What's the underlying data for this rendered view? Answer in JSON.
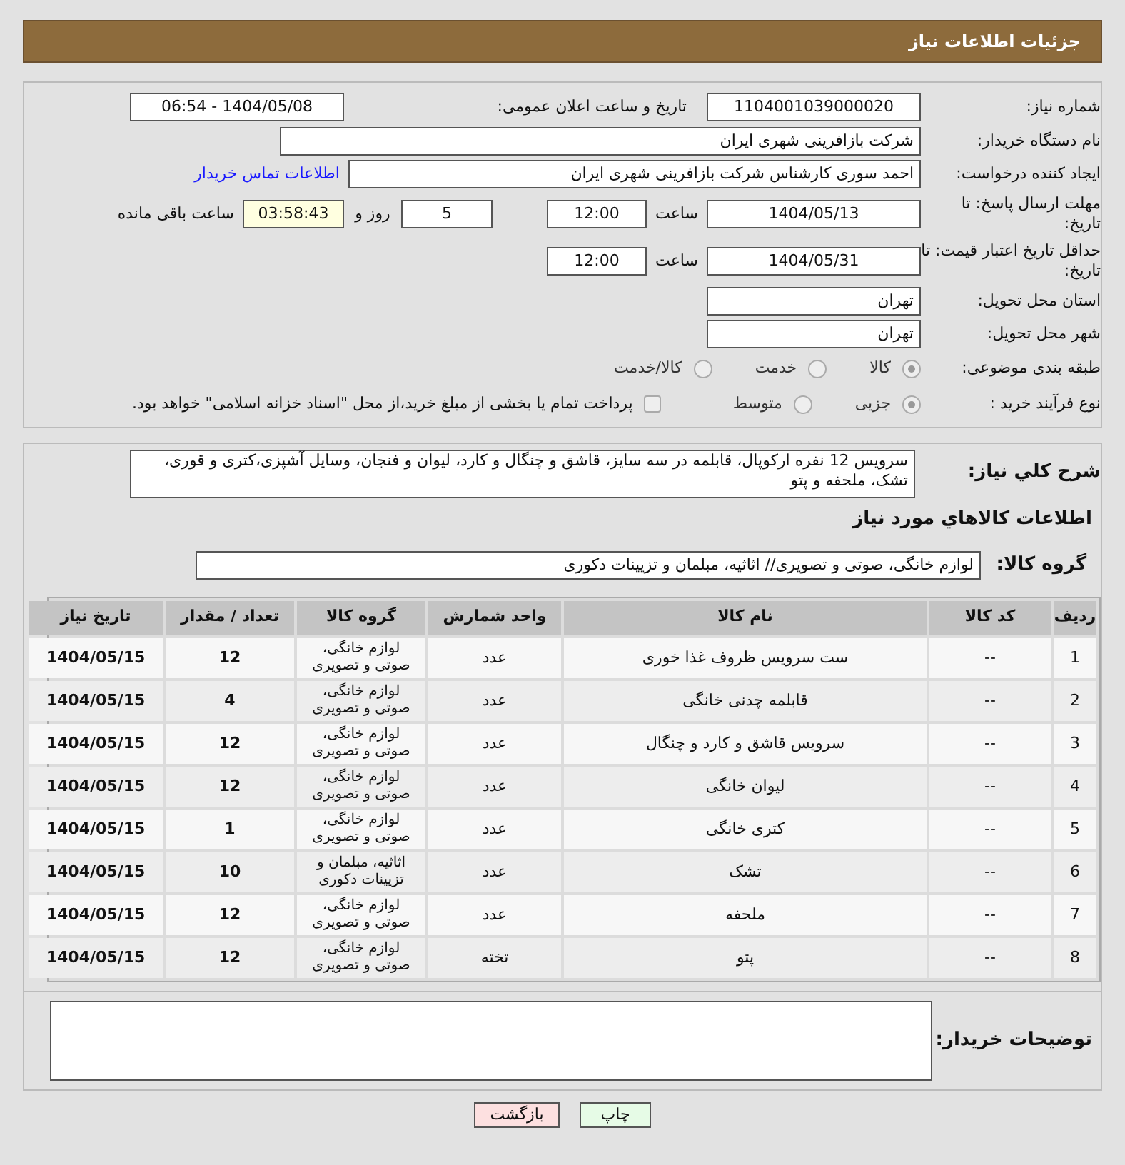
{
  "header": {
    "title": "جزئیات اطلاعات نیاز"
  },
  "need_number": {
    "label": "شماره نیاز:",
    "value": "1104001039000020"
  },
  "announce": {
    "label": "تاریخ و ساعت اعلان عمومی:",
    "value": "1404/05/08 - 06:54"
  },
  "buyer_org": {
    "label": "نام دستگاه خریدار:",
    "value": "شرکت بازافرینی شهری ایران"
  },
  "requester": {
    "label": "ایجاد کننده درخواست:",
    "value": "احمد سوری کارشناس شرکت بازافرینی شهری ایران",
    "link": "اطلاعات تماس خریدار"
  },
  "reply_deadline": {
    "label": "مهلت ارسال پاسخ: تا تاریخ:",
    "date": "1404/05/13",
    "time_label": "ساعت",
    "time": "12:00",
    "days": "5",
    "days_label": "روز و",
    "remaining": "03:58:43",
    "remaining_label": "ساعت باقی مانده"
  },
  "price_validity": {
    "label": "حداقل تاریخ اعتبار قیمت: تا تاریخ:",
    "date": "1404/05/31",
    "time_label": "ساعت",
    "time": "12:00"
  },
  "province": {
    "label": "استان محل تحویل:",
    "value": "تهران"
  },
  "city": {
    "label": "شهر محل تحویل:",
    "value": "تهران"
  },
  "classification": {
    "label": "طبقه بندی موضوعی:",
    "options": [
      {
        "label": "کالا",
        "selected": true
      },
      {
        "label": "خدمت",
        "selected": false
      },
      {
        "label": "کالا/خدمت",
        "selected": false
      }
    ]
  },
  "purchase_type": {
    "label": "نوع فرآیند خرید :",
    "options": [
      {
        "label": "جزیی",
        "selected": true
      },
      {
        "label": "متوسط",
        "selected": false
      }
    ],
    "treasury": {
      "checked": false,
      "label": "پرداخت تمام یا بخشی از مبلغ خرید،از محل \"اسناد خزانه اسلامی\" خواهد بود."
    }
  },
  "description": {
    "label": "شرح کلي نياز:",
    "value": "سرویس 12 نفره ارکوپال، قابلمه در سه سایز، قاشق و چنگال و کارد، لیوان و فنجان، وسایل آشپزی،کتری و قوری، تشک، ملحفه و پتو"
  },
  "items_heading": "اطلاعات كالاهاي مورد نياز",
  "goods_group": {
    "label": "گروه کالا:",
    "value": "لوازم خانگی، صوتی و تصویری// اثاثیه، مبلمان و تزیینات دکوری"
  },
  "table": {
    "columns": [
      "ردیف",
      "کد کالا",
      "نام کالا",
      "واحد شمارش",
      "گروه کالا",
      "تعداد / مقدار",
      "تاریخ نیاز"
    ],
    "rows": [
      [
        "1",
        "--",
        "ست سرویس ظروف غذا خوری",
        "عدد",
        "لوازم خانگی، صوتی و تصویری",
        "12",
        "1404/05/15"
      ],
      [
        "2",
        "--",
        "قابلمه چدنی خانگی",
        "عدد",
        "لوازم خانگی، صوتی و تصویری",
        "4",
        "1404/05/15"
      ],
      [
        "3",
        "--",
        "سرویس قاشق و کارد و چنگال",
        "عدد",
        "لوازم خانگی، صوتی و تصویری",
        "12",
        "1404/05/15"
      ],
      [
        "4",
        "--",
        "لیوان خانگی",
        "عدد",
        "لوازم خانگی، صوتی و تصویری",
        "12",
        "1404/05/15"
      ],
      [
        "5",
        "--",
        "کتری خانگی",
        "عدد",
        "لوازم خانگی، صوتی و تصویری",
        "1",
        "1404/05/15"
      ],
      [
        "6",
        "--",
        "تشک",
        "عدد",
        "اثاثیه، مبلمان و تزیینات دکوری",
        "10",
        "1404/05/15"
      ],
      [
        "7",
        "--",
        "ملحفه",
        "عدد",
        "لوازم خانگی، صوتی و تصویری",
        "12",
        "1404/05/15"
      ],
      [
        "8",
        "--",
        "پتو",
        "تخته",
        "لوازم خانگی، صوتی و تصویری",
        "12",
        "1404/05/15"
      ]
    ]
  },
  "buyer_notes": {
    "label": "توضیحات خریدار:"
  },
  "buttons": [
    {
      "label": "چاپ",
      "kind": "print"
    },
    {
      "label": "بازگشت",
      "kind": "back"
    }
  ]
}
